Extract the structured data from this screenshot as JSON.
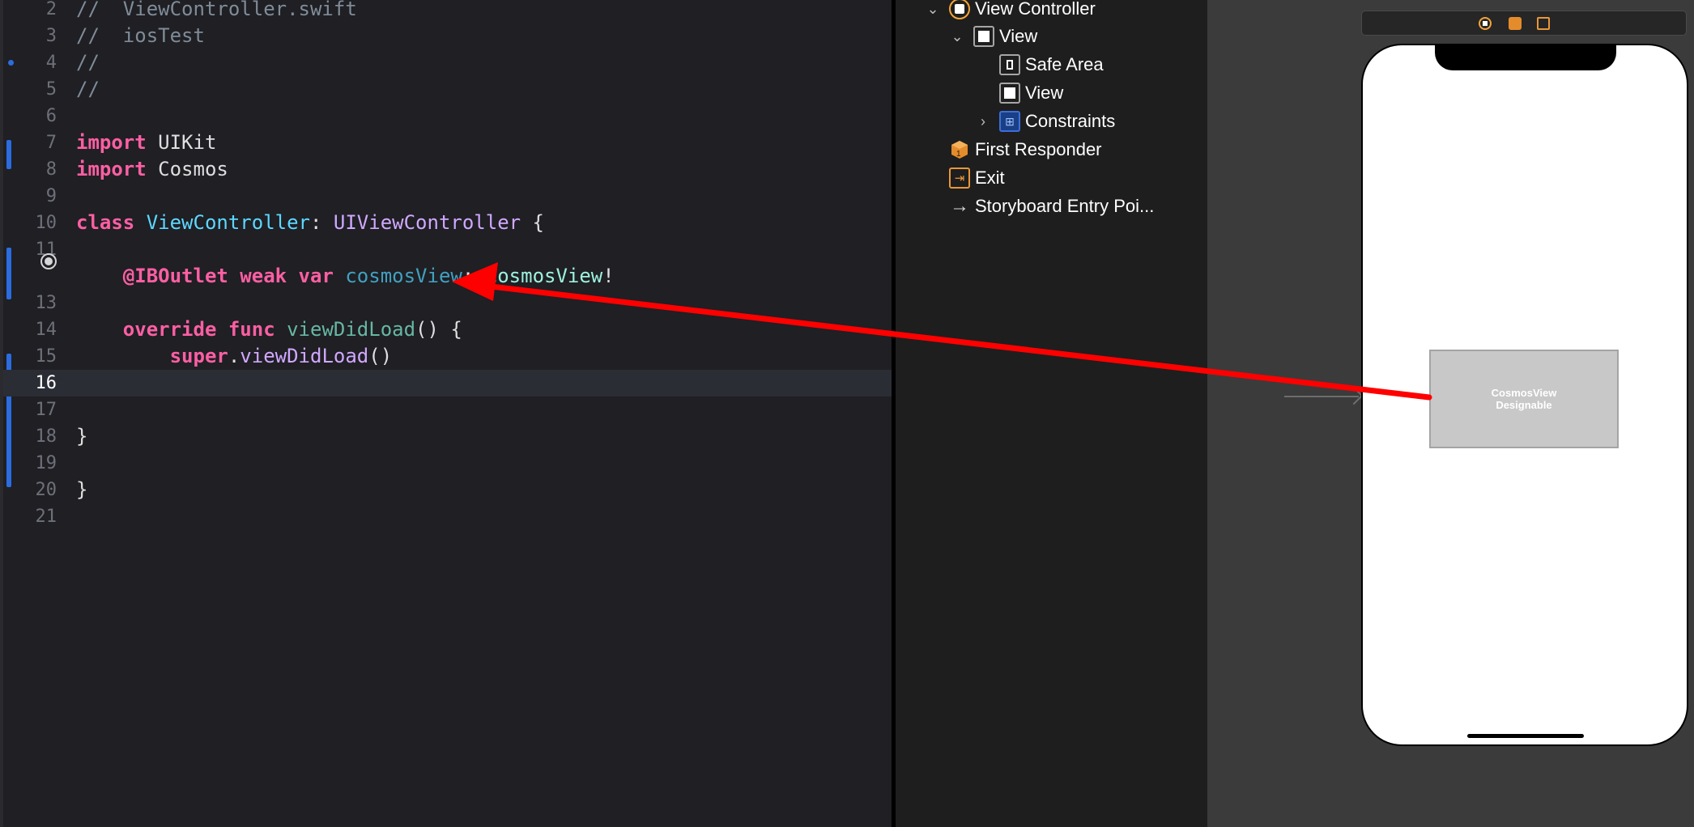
{
  "editor": {
    "lines": [
      {
        "num": "2",
        "tokens": [
          {
            "c": "t-comment",
            "t": "//  ViewController.swift"
          }
        ]
      },
      {
        "num": "3",
        "tokens": [
          {
            "c": "t-comment",
            "t": "//  iosTest"
          }
        ]
      },
      {
        "num": "4",
        "tokens": [
          {
            "c": "t-comment",
            "t": "//"
          }
        ]
      },
      {
        "num": "5",
        "tokens": [
          {
            "c": "t-comment",
            "t": "//"
          }
        ]
      },
      {
        "num": "6",
        "tokens": []
      },
      {
        "num": "7",
        "tokens": [
          {
            "c": "t-kw",
            "t": "import"
          },
          {
            "c": "t-plain",
            "t": " UIKit"
          }
        ]
      },
      {
        "num": "8",
        "tokens": [
          {
            "c": "t-kw",
            "t": "import"
          },
          {
            "c": "t-plain",
            "t": " Cosmos"
          }
        ]
      },
      {
        "num": "9",
        "tokens": []
      },
      {
        "num": "10",
        "tokens": [
          {
            "c": "t-kw",
            "t": "class"
          },
          {
            "c": "t-plain",
            "t": " "
          },
          {
            "c": "t-type",
            "t": "ViewController"
          },
          {
            "c": "t-plain",
            "t": ": "
          },
          {
            "c": "t-ptype",
            "t": "UIViewController"
          },
          {
            "c": "t-plain",
            "t": " {"
          }
        ]
      },
      {
        "num": "11",
        "tokens": []
      },
      {
        "num": "",
        "tokens": [
          {
            "c": "t-plain",
            "t": "    "
          },
          {
            "c": "t-kw",
            "t": "@IBOutlet"
          },
          {
            "c": "t-plain",
            "t": " "
          },
          {
            "c": "t-kw",
            "t": "weak"
          },
          {
            "c": "t-plain",
            "t": " "
          },
          {
            "c": "t-kw",
            "t": "var"
          },
          {
            "c": "t-plain",
            "t": " "
          },
          {
            "c": "t-prop",
            "t": "cosmosView"
          },
          {
            "c": "t-plain",
            "t": ": "
          },
          {
            "c": "t-tproj",
            "t": "CosmosView"
          },
          {
            "c": "t-plain",
            "t": "!"
          }
        ]
      },
      {
        "num": "13",
        "tokens": []
      },
      {
        "num": "14",
        "tokens": [
          {
            "c": "t-plain",
            "t": "    "
          },
          {
            "c": "t-kw",
            "t": "override"
          },
          {
            "c": "t-plain",
            "t": " "
          },
          {
            "c": "t-kw",
            "t": "func"
          },
          {
            "c": "t-plain",
            "t": " "
          },
          {
            "c": "t-method",
            "t": "viewDidLoad"
          },
          {
            "c": "t-plain",
            "t": "() {"
          }
        ]
      },
      {
        "num": "15",
        "tokens": [
          {
            "c": "t-plain",
            "t": "        "
          },
          {
            "c": "t-kw",
            "t": "super"
          },
          {
            "c": "t-plain",
            "t": "."
          },
          {
            "c": "t-ptype",
            "t": "viewDidLoad"
          },
          {
            "c": "t-plain",
            "t": "()"
          }
        ]
      },
      {
        "num": "16",
        "tokens": [],
        "current": true
      },
      {
        "num": "17",
        "tokens": []
      },
      {
        "num": "18",
        "tokens": [
          {
            "c": "t-plain",
            "t": "}"
          }
        ]
      },
      {
        "num": "19",
        "tokens": []
      },
      {
        "num": "20",
        "tokens": [
          {
            "c": "t-plain",
            "t": "}"
          }
        ]
      },
      {
        "num": "21",
        "tokens": []
      }
    ]
  },
  "outline": {
    "items": [
      {
        "label": "View Controller",
        "icon": "view-controller-icon",
        "chevron": "expanded"
      },
      {
        "label": "View",
        "icon": "view-icon",
        "chevron": "expanded"
      },
      {
        "label": "Safe Area",
        "icon": "safe-area-icon",
        "chevron": "none"
      },
      {
        "label": "View",
        "icon": "view-icon",
        "chevron": "none"
      },
      {
        "label": "Constraints",
        "icon": "constraints-icon",
        "chevron": "collapsed"
      },
      {
        "label": "First Responder",
        "icon": "first-responder-icon",
        "chevron": "none"
      },
      {
        "label": "Exit",
        "icon": "exit-icon",
        "chevron": "none"
      },
      {
        "label": "Storyboard Entry Poi...",
        "icon": "entry-point-arrow-icon",
        "chevron": "none"
      }
    ]
  },
  "canvas": {
    "cosmos_view": {
      "line1": "CosmosView",
      "line2": "Designable"
    }
  },
  "colors": {
    "editor_bg": "#1f1f24",
    "keyword": "#fc5fa3",
    "change_bar": "#2b6de0",
    "annotation_arrow": "#ff0000",
    "outline_bg": "#1e1e1e",
    "canvas_bg": "#3b3b3b"
  }
}
